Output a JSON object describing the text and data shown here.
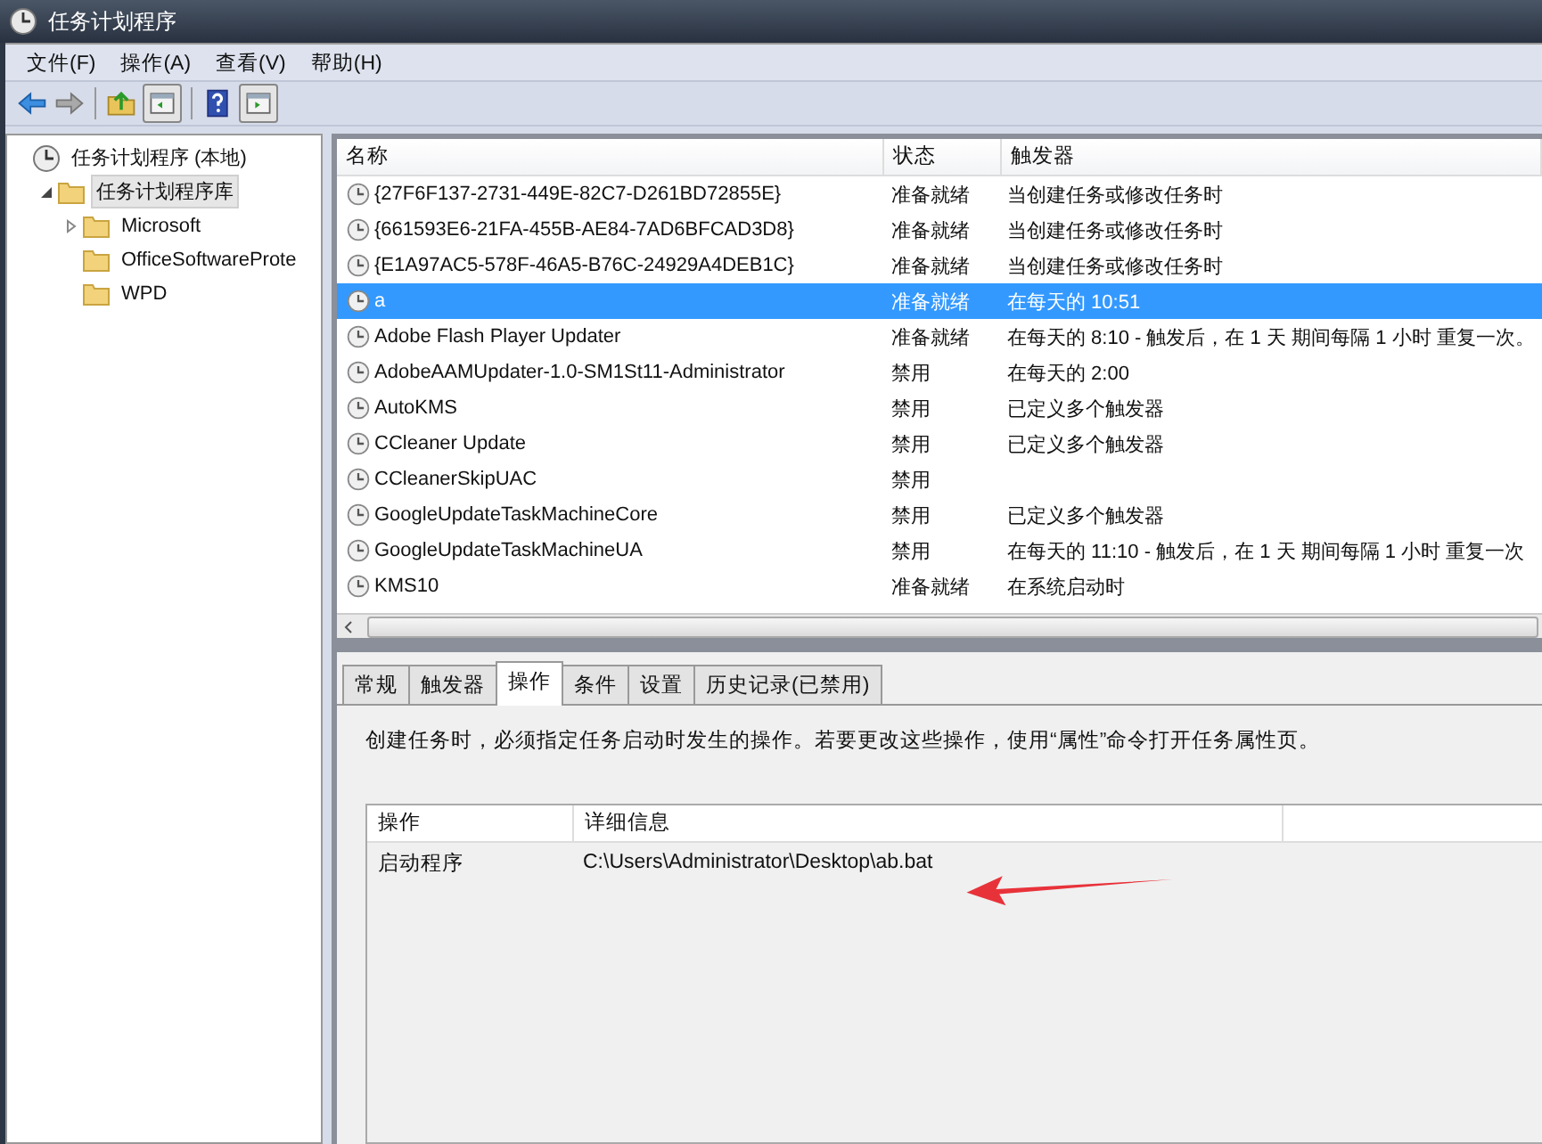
{
  "window": {
    "title": "任务计划程序"
  },
  "menu": [
    "文件(F)",
    "操作(A)",
    "查看(V)",
    "帮助(H)"
  ],
  "tree": [
    {
      "label": "任务计划程序 (本地)",
      "selected": false,
      "children": [
        {
          "label": "任务计划程序库",
          "selected": true,
          "expanded": true,
          "children": [
            {
              "label": "Microsoft",
              "selected": false,
              "expanded": false
            },
            {
              "label": "OfficeSoftwareProte",
              "selected": false
            },
            {
              "label": "WPD",
              "selected": false
            }
          ]
        }
      ]
    }
  ],
  "table": {
    "columns": [
      "名称",
      "状态",
      "触发器"
    ],
    "rows": [
      {
        "name": "{27F6F137-2731-449E-82C7-D261BD72855E}",
        "status": "准备就绪",
        "trigger": "当创建任务或修改任务时",
        "selected": false
      },
      {
        "name": "{661593E6-21FA-455B-AE84-7AD6BFCAD3D8}",
        "status": "准备就绪",
        "trigger": "当创建任务或修改任务时",
        "selected": false
      },
      {
        "name": "{E1A97AC5-578F-46A5-B76C-24929A4DEB1C}",
        "status": "准备就绪",
        "trigger": "当创建任务或修改任务时",
        "selected": false
      },
      {
        "name": "a",
        "status": "准备就绪",
        "trigger": "在每天的 10:51",
        "selected": true
      },
      {
        "name": "Adobe Flash Player Updater",
        "status": "准备就绪",
        "trigger": "在每天的 8:10 - 触发后，在 1 天 期间每隔 1 小时 重复一次。",
        "selected": false
      },
      {
        "name": "AdobeAAMUpdater-1.0-SM1St11-Administrator",
        "status": "禁用",
        "trigger": "在每天的 2:00",
        "selected": false
      },
      {
        "name": "AutoKMS",
        "status": "禁用",
        "trigger": "已定义多个触发器",
        "selected": false
      },
      {
        "name": "CCleaner Update",
        "status": "禁用",
        "trigger": "已定义多个触发器",
        "selected": false
      },
      {
        "name": "CCleanerSkipUAC",
        "status": "禁用",
        "selected": false
      },
      {
        "name": "GoogleUpdateTaskMachineCore",
        "status": "禁用",
        "trigger": "已定义多个触发器",
        "selected": false
      },
      {
        "name": "GoogleUpdateTaskMachineUA",
        "status": "禁用",
        "trigger": "在每天的 11:10 - 触发后，在 1 天 期间每隔 1 小时 重复一次",
        "selected": false
      },
      {
        "name": "KMS10",
        "status": "准备就绪",
        "trigger": "在系统启动时",
        "selected": false
      }
    ]
  },
  "tabs": [
    {
      "label": "常规",
      "selected": false
    },
    {
      "label": "触发器",
      "selected": false
    },
    {
      "label": "操作",
      "selected": true
    },
    {
      "label": "条件",
      "selected": false
    },
    {
      "label": "设置",
      "selected": false
    },
    {
      "label": "历史记录(已禁用)",
      "selected": false
    }
  ],
  "actions_tab": {
    "description": "创建任务时，必须指定任务启动时发生的操作。若要更改这些操作，使用“属性”命令打开任务属性页。",
    "columns": [
      "操作",
      "详细信息"
    ],
    "rows": [
      {
        "action": "启动程序",
        "details": "C:\\Users\\Administrator\\Desktop\\ab.bat"
      }
    ]
  }
}
